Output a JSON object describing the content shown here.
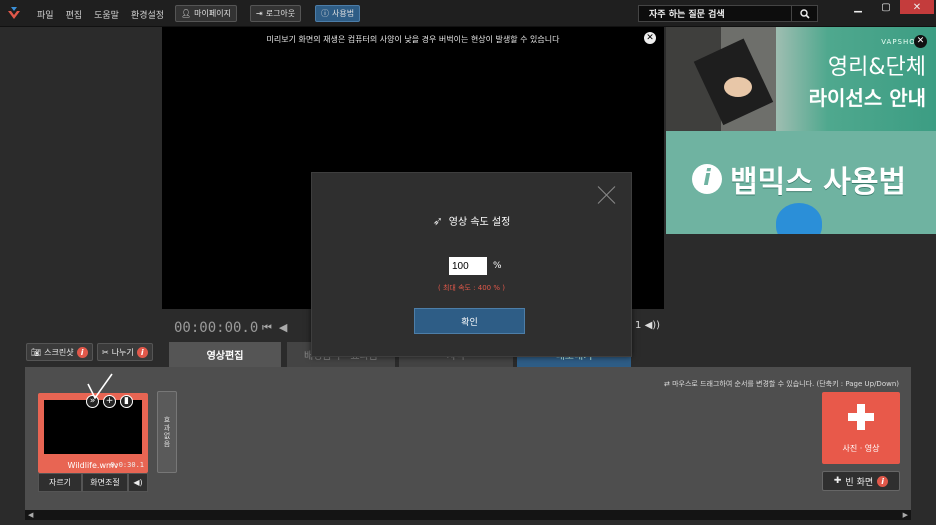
{
  "menu": [
    "파일",
    "편집",
    "도움말",
    "환경설정"
  ],
  "top_buttons": {
    "mypage": "마이페이지",
    "logout": "로그아웃",
    "howto": "사용법"
  },
  "search": {
    "label": "자주 하는 질문 검색"
  },
  "preview": {
    "note": "미리보기 화면의 재생은 컴퓨터의 사양이 낮을 경우 버벅이는 현상이 발생할 수 있습니다"
  },
  "ads": {
    "top": {
      "brand": "VAPSHON",
      "line1": "영리&단체",
      "line2": "라이선스 안내"
    },
    "bottom": {
      "text": "뱁믹스 사용법"
    }
  },
  "player": {
    "timecode": "00:00:00.0",
    "right_num": "1"
  },
  "toolbar": {
    "screenshot": "스크린샷",
    "split": "나누기"
  },
  "tabs": [
    {
      "label": "영상편집"
    },
    {
      "label": "배경음악 · 효과음"
    },
    {
      "label": "자막"
    },
    {
      "label": "내보내기"
    }
  ],
  "timeline": {
    "hint": "마우스로 드래그하여 순서를 변경할 수 있습니다. (단축키 : Page Up/Down)",
    "clip": {
      "duration": "0:0:30.1",
      "name": "Wildlife.wmv"
    },
    "clip_buttons": {
      "trim": "자르기",
      "resize": "화면조절"
    },
    "effect": "효과없음",
    "add_label": "사진 · 영상",
    "blank_label": "빈 화면"
  },
  "modal": {
    "title": "영상 속도 설정",
    "value": "100",
    "unit": "%",
    "max_note": "( 최대 속도 : 400 % )",
    "confirm": "확인"
  },
  "colors": {
    "accent": "#2e5d86",
    "clip": "#e86553",
    "add": "#e8594a",
    "ad_green": "#6fb3a1"
  }
}
